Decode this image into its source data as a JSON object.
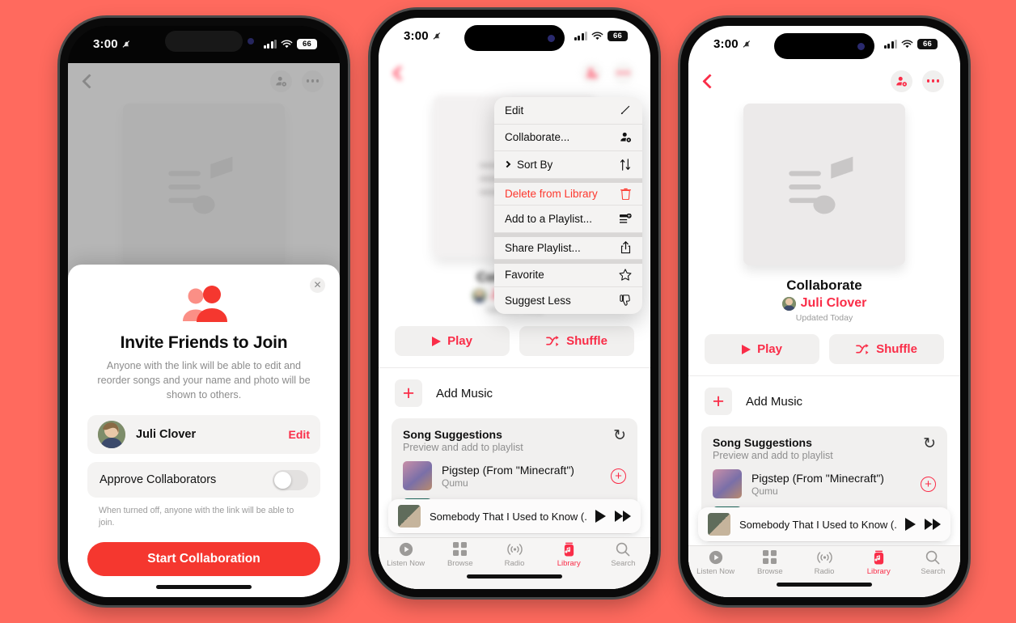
{
  "background_color": "#ff6a5e",
  "accent_color": "#fa2d48",
  "status_bar": {
    "time": "3:00",
    "mute_icon": "bell-slash-icon",
    "signal_icon": "cellular-bars-icon",
    "wifi_icon": "wifi-icon",
    "battery_level": "66"
  },
  "playlist": {
    "title": "Collaborate",
    "owner": "Juli Clover",
    "updated": "Updated Today",
    "artwork_icon": "music-note-placeholder-icon",
    "play_label": "Play",
    "shuffle_label": "Shuffle",
    "add_music_label": "Add Music",
    "back_icon": "chevron-left-icon",
    "collaborate_icon": "person-add-icon",
    "more_icon": "ellipsis-icon"
  },
  "suggestions": {
    "title": "Song Suggestions",
    "subtitle": "Preview and add to playlist",
    "refresh_icon": "refresh-icon",
    "songs": [
      {
        "title": "Pigstep (From \"Minecraft\")",
        "artist": "Qumu",
        "add_icon": "plus-circle-icon"
      }
    ]
  },
  "mini_player": {
    "track": "Somebody That I Used to Know (...",
    "play_icon": "play-icon",
    "forward_icon": "fast-forward-icon"
  },
  "tab_bar": {
    "items": [
      {
        "label": "Listen Now",
        "icon": "play-circle-icon",
        "active": false
      },
      {
        "label": "Browse",
        "icon": "grid-icon",
        "active": false
      },
      {
        "label": "Radio",
        "icon": "broadcast-icon",
        "active": false
      },
      {
        "label": "Library",
        "icon": "library-icon",
        "active": true
      },
      {
        "label": "Search",
        "icon": "search-icon",
        "active": false
      }
    ]
  },
  "invite_sheet": {
    "close_icon": "close-icon",
    "hero_icon": "two-people-icon",
    "title": "Invite Friends to Join",
    "body": "Anyone with the link will be able to edit and reorder songs and your name and photo will be shown to others.",
    "user_name": "Juli Clover",
    "edit_label": "Edit",
    "toggle_label": "Approve Collaborators",
    "toggle_state": "off",
    "hint": "When turned off, anyone with the link will be able to join.",
    "cta_label": "Start Collaboration"
  },
  "context_menu": {
    "items": [
      {
        "label": "Edit",
        "icon": "pencil-icon",
        "destructive": false,
        "submenu": false,
        "group": 1
      },
      {
        "label": "Collaborate...",
        "icon": "person-add-icon",
        "destructive": false,
        "submenu": false,
        "group": 1
      },
      {
        "label": "Sort By",
        "icon": "sort-arrows-icon",
        "destructive": false,
        "submenu": true,
        "group": 1
      },
      {
        "label": "Delete from Library",
        "icon": "trash-icon",
        "destructive": true,
        "submenu": false,
        "group": 2
      },
      {
        "label": "Add to a Playlist...",
        "icon": "add-to-playlist-icon",
        "destructive": false,
        "submenu": false,
        "group": 2
      },
      {
        "label": "Share Playlist...",
        "icon": "share-icon",
        "destructive": false,
        "submenu": false,
        "group": 3
      },
      {
        "label": "Favorite",
        "icon": "star-icon",
        "destructive": false,
        "submenu": false,
        "group": 4
      },
      {
        "label": "Suggest Less",
        "icon": "thumbs-down-icon",
        "destructive": false,
        "submenu": false,
        "group": 4
      }
    ]
  }
}
